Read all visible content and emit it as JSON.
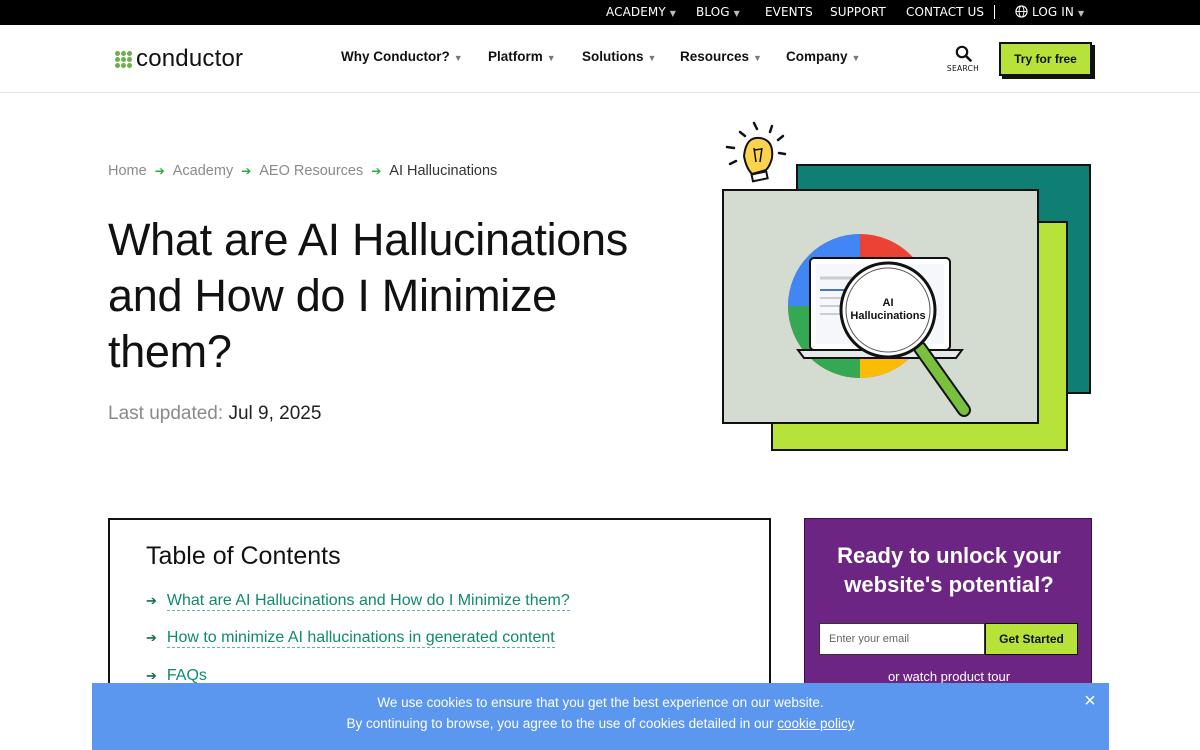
{
  "topbar": {
    "academy": "ACADEMY",
    "blog": "BLOG",
    "events": "EVENTS",
    "support": "SUPPORT",
    "contact": "CONTACT US",
    "login": "LOG IN"
  },
  "header": {
    "logo_text": "conductor",
    "nav": {
      "why": "Why Conductor?",
      "platform": "Platform",
      "solutions": "Solutions",
      "resources": "Resources",
      "company": "Company"
    },
    "search_label": "SEARCH",
    "cta": "Try for free"
  },
  "breadcrumb": {
    "home": "Home",
    "academy": "Academy",
    "aeo": "AEO Resources",
    "current": "AI Hallucinations"
  },
  "hero": {
    "title": "What are AI Hallucinations and How do I Minimize them?",
    "updated_label": "Last updated:",
    "updated_date": "Jul 9, 2025",
    "illustration_label_1": "AI",
    "illustration_label_2": "Hallucinations"
  },
  "toc": {
    "title": "Table of Contents",
    "items": [
      "What are AI Hallucinations and How do I Minimize them?",
      "How to minimize AI hallucinations in generated content",
      "FAQs"
    ]
  },
  "promo": {
    "title": "Ready to unlock your website's potential?",
    "email_placeholder": "Enter your email",
    "button": "Get Started",
    "tour": "or watch product tour"
  },
  "cookie": {
    "line1": "We use cookies to ensure that you get the best experience on our website.",
    "line2_prefix": "By continuing to browse, you agree to the use of cookies detailed in our ",
    "link": "cookie policy",
    "close": "×"
  },
  "colors": {
    "accent_green": "#b6e23a",
    "teal": "#0e7f72",
    "promo_purple": "#6c2582",
    "cookie_blue": "#5b97ef",
    "link_green": "#0f8a6b"
  }
}
